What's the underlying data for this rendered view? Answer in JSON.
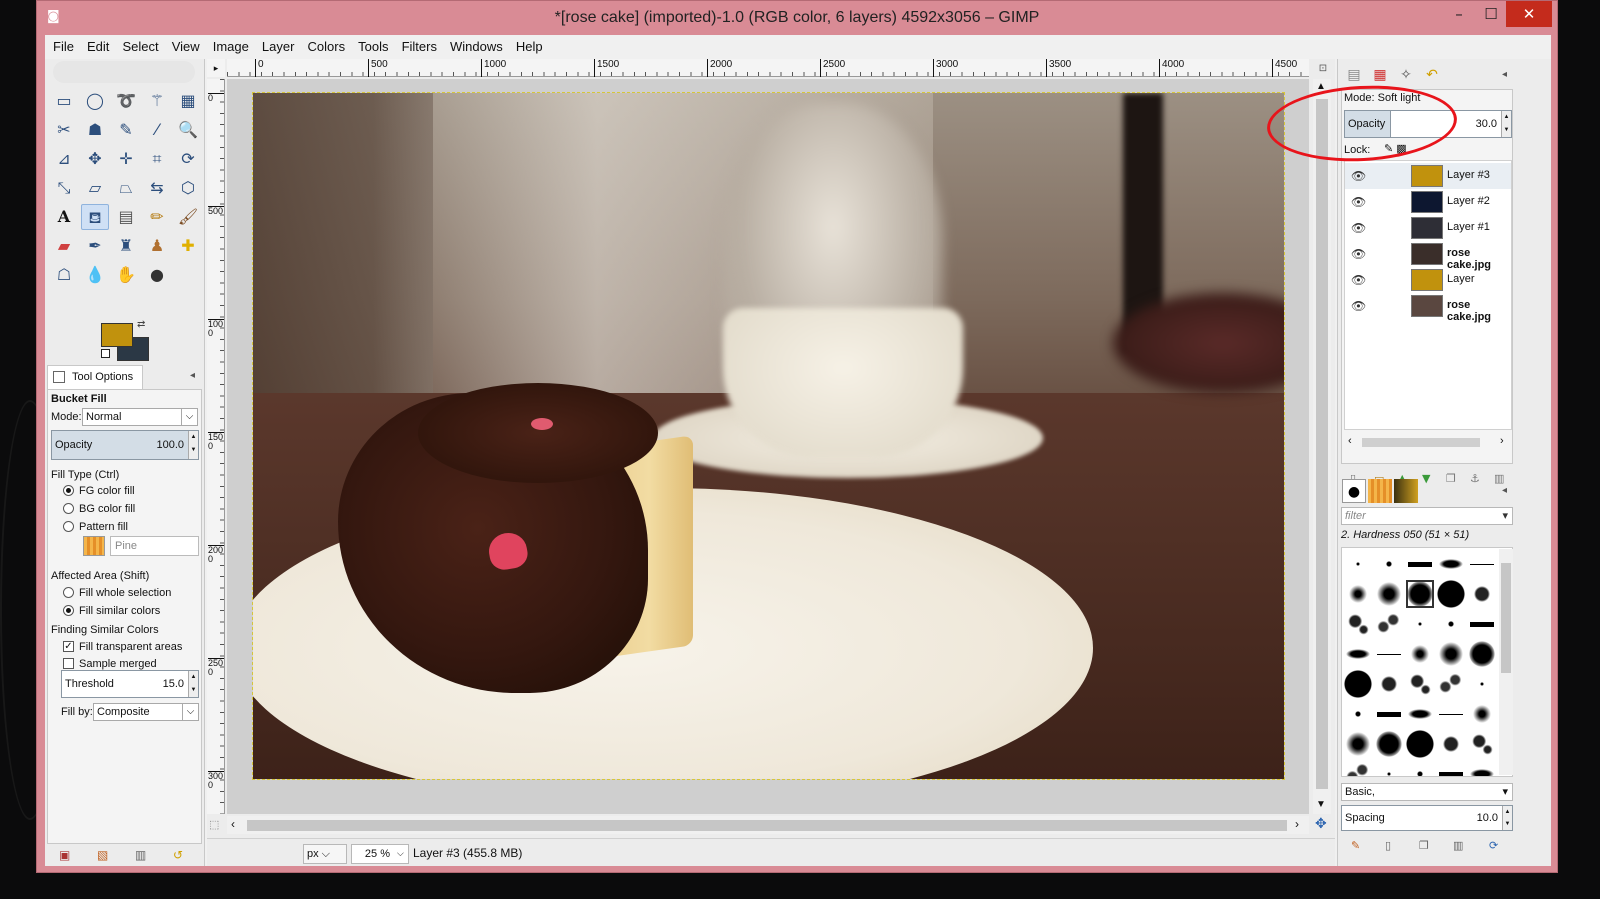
{
  "window": {
    "title": "*[rose cake] (imported)-1.0 (RGB color, 6 layers) 4592x3056 – GIMP",
    "min_glyph": "–",
    "max_glyph": "☐",
    "close_glyph": "✕"
  },
  "menu": [
    "File",
    "Edit",
    "Select",
    "View",
    "Image",
    "Layer",
    "Colors",
    "Tools",
    "Filters",
    "Windows",
    "Help"
  ],
  "colors": {
    "foreground": "#c1920d",
    "background": "#2b3845",
    "window_frame": "#d98b95",
    "highlight": "#e8141b"
  },
  "tool_options": {
    "tab_label": "Tool Options",
    "tool_name": "Bucket Fill",
    "mode_label": "Mode:",
    "mode_value": "Normal",
    "opacity_label": "Opacity",
    "opacity_value": "100.0",
    "fill_type_label": "Fill Type  (Ctrl)",
    "fill_types": [
      "FG color fill",
      "BG color fill",
      "Pattern fill"
    ],
    "pattern_name": "Pine",
    "affected_area_label": "Affected Area  (Shift)",
    "affected_areas": [
      "Fill whole selection",
      "Fill similar colors"
    ],
    "finding_label": "Finding Similar Colors",
    "fill_transparent": "Fill transparent areas",
    "sample_merged": "Sample merged",
    "threshold_label": "Threshold",
    "threshold_value": "15.0",
    "fill_by_label": "Fill by:",
    "fill_by_value": "Composite"
  },
  "ruler": {
    "h_ticks": [
      "0",
      "500",
      "1000",
      "1500",
      "2000",
      "2500",
      "3000",
      "3500",
      "4000",
      "4500"
    ],
    "v_ticks": [
      "0",
      "500",
      "1000",
      "1500",
      "2000",
      "2500",
      "3000"
    ]
  },
  "status": {
    "unit": "px",
    "zoom": "25 %",
    "text": "Layer #3 (455.8 MB)"
  },
  "layers": {
    "mode_text": "Mode: Soft light",
    "opacity_label": "Opacity",
    "opacity_value": "30.0",
    "lock_label": "Lock:",
    "items": [
      {
        "name": "Layer #3",
        "color": "#c1920d",
        "bold": false
      },
      {
        "name": "Layer #2",
        "color": "#0d1730",
        "bold": false
      },
      {
        "name": "Layer #1",
        "color": "#2e2e36",
        "bold": false
      },
      {
        "name": "rose cake.jpg",
        "color": "#3a2e2a",
        "bold": true
      },
      {
        "name": "Layer",
        "color": "#c1920d",
        "bold": false
      },
      {
        "name": "rose cake.jpg",
        "color": "#5a4740",
        "bold": true
      }
    ]
  },
  "brushes": {
    "filter_placeholder": "filter",
    "selected_brush": "2. Hardness 050 (51 × 51)",
    "tag_value": "Basic,",
    "spacing_label": "Spacing",
    "spacing_value": "10.0"
  }
}
